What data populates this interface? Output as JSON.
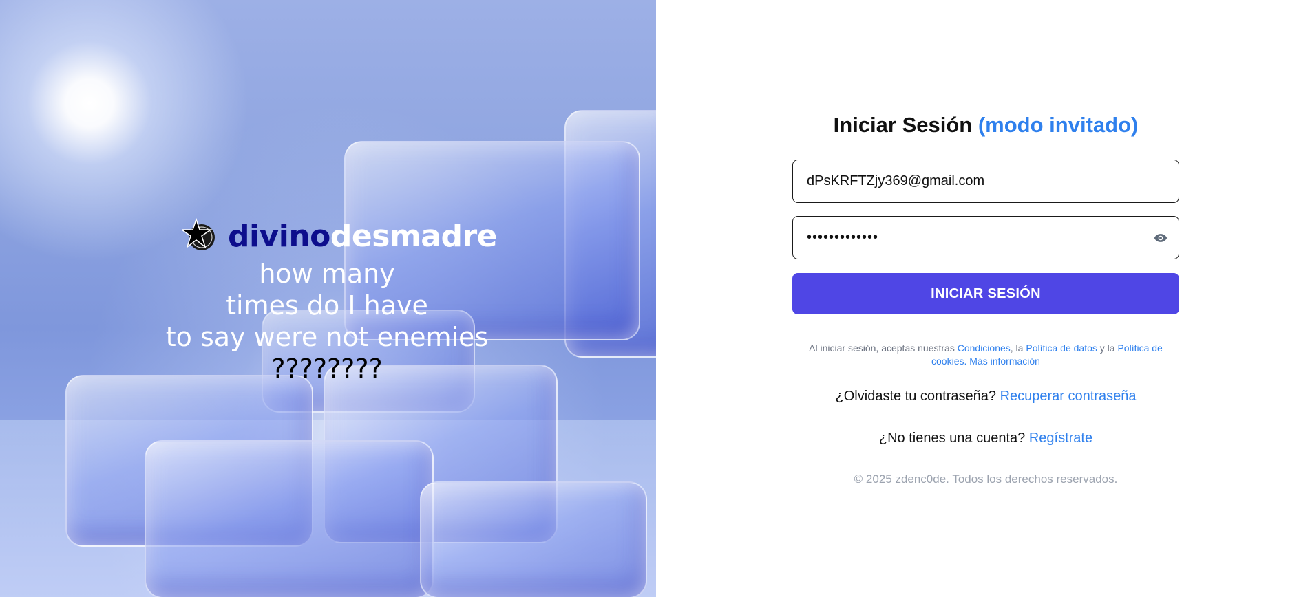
{
  "hero": {
    "brand_part1": "divino",
    "brand_part2": "desmadre",
    "tagline_lines": [
      "how many",
      "times do I have",
      "to say were not enemies"
    ],
    "tagline_question": "????????"
  },
  "login": {
    "title": "Iniciar Sesión",
    "title_accent": "(modo invitado)",
    "email_value": "dPsKRFTZjy369@gmail.com",
    "password_value": "•••••••••••••",
    "submit_label": "INICIAR SESIÓN",
    "legal": {
      "prefix": "Al iniciar sesión, aceptas nuestras",
      "conditions_link": "Condiciones",
      "sep1": ", la",
      "data_policy_link": "Política de datos",
      "sep2": "y la",
      "cookies_policy_link": "Política de cookies.",
      "more_info_link": "Más información"
    },
    "forgot_text": "¿Olvidaste tu contraseña?",
    "forgot_link": "Recuperar contraseña",
    "register_text": "¿No tienes una cuenta?",
    "register_link": "Regístrate",
    "copyright": "© 2025 zdenc0de. Todos los derechos reservados."
  },
  "icons": {
    "logo": "star-logo-icon",
    "password_toggle": "eye-icon"
  },
  "colors": {
    "accent": "#2f80ed",
    "button": "#4f46e5",
    "brand_dark": "#0d0e8c"
  }
}
